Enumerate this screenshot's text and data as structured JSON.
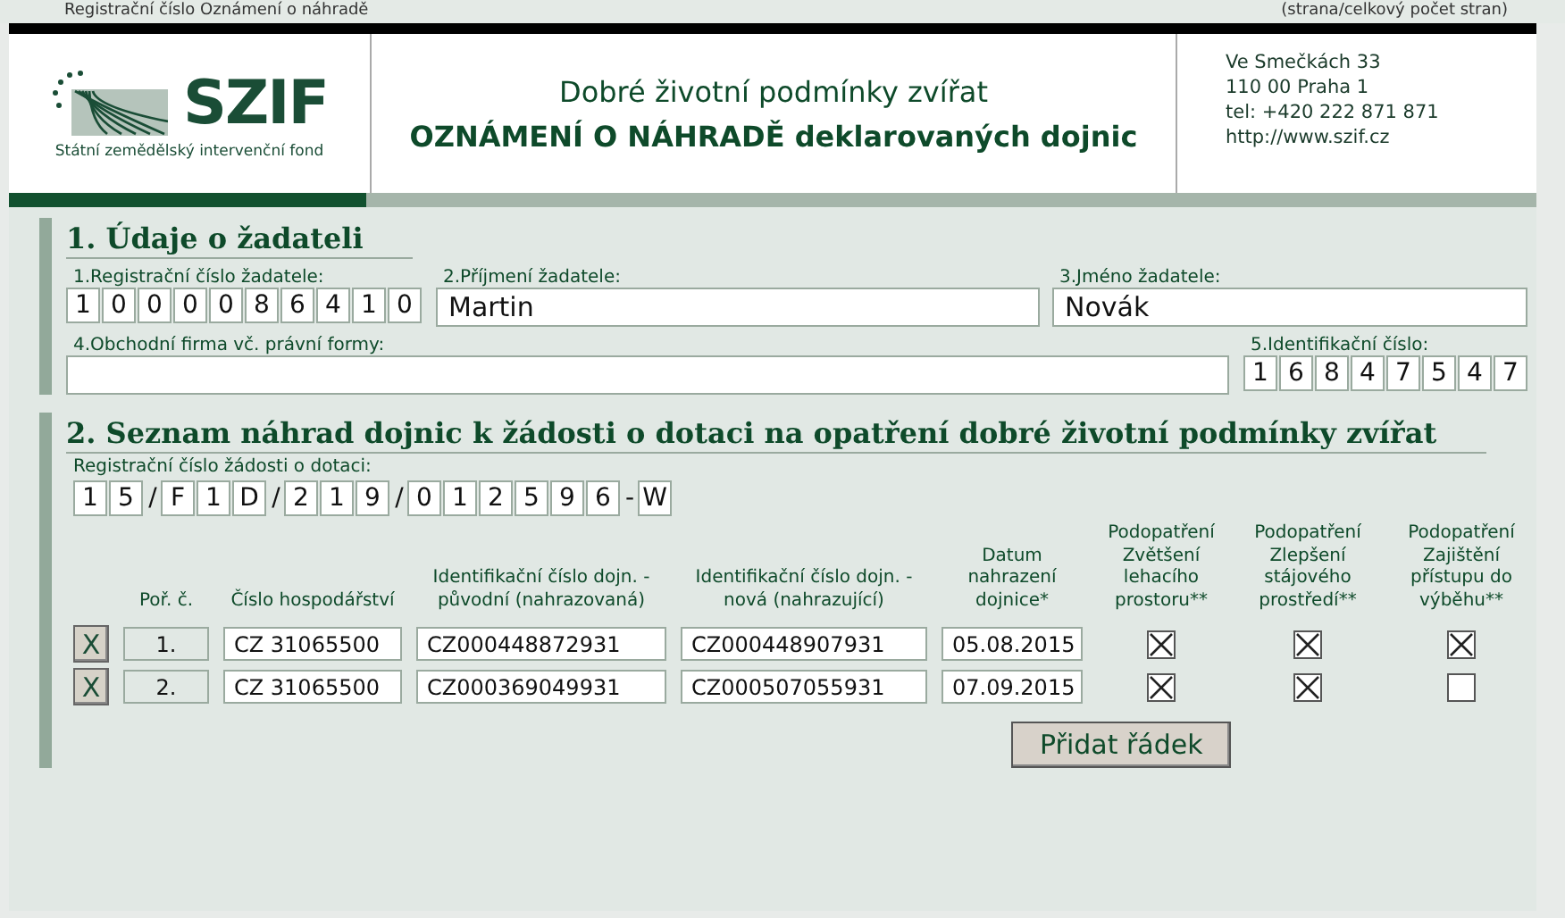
{
  "top_strip": {
    "left": "Registrační číslo Oznámení o náhradě",
    "right": "(strana/celkový počet stran)"
  },
  "header": {
    "logo_text": "SZIF",
    "logo_caption": "Státní zemědělský intervenční fond",
    "subtitle": "Dobré životní podmínky zvířat",
    "title": "OZNÁMENÍ O NÁHRADĚ deklarovaných dojnic",
    "address": [
      "Ve Smečkách 33",
      "110 00 Praha 1",
      "tel: +420 222 871 871",
      "http://www.szif.cz"
    ]
  },
  "section1": {
    "heading": "1. Údaje o žadateli",
    "reg_label": "1.Registrační číslo žadatele:",
    "reg_digits": [
      "1",
      "0",
      "0",
      "0",
      "0",
      "8",
      "6",
      "4",
      "1",
      "0"
    ],
    "surname_label": "2.Příjmení žadatele:",
    "surname": "Martin",
    "name_label": "3.Jméno žadatele:",
    "name": "Novák",
    "firm_label": "4.Obchodní firma vč. právní formy:",
    "id_label": "5.Identifikační číslo:",
    "id_digits": [
      "1",
      "6",
      "8",
      "4",
      "7",
      "5",
      "4",
      "7"
    ]
  },
  "section2": {
    "heading": "2. Seznam náhrad dojnic k žádosti o dotaci na opatření dobré životní podmínky zvířat",
    "app_label": "Registrační číslo žádosti o dotaci:",
    "app_number": [
      {
        "kind": "cell",
        "text": "1"
      },
      {
        "kind": "cell",
        "text": "5"
      },
      {
        "kind": "sep",
        "text": "/"
      },
      {
        "kind": "cell",
        "text": "F"
      },
      {
        "kind": "cell",
        "text": "1"
      },
      {
        "kind": "cell",
        "text": "D"
      },
      {
        "kind": "sep",
        "text": "/"
      },
      {
        "kind": "cell",
        "text": "2"
      },
      {
        "kind": "cell",
        "text": "1"
      },
      {
        "kind": "cell",
        "text": "9"
      },
      {
        "kind": "sep",
        "text": "/"
      },
      {
        "kind": "cell",
        "text": "0"
      },
      {
        "kind": "cell",
        "text": "1"
      },
      {
        "kind": "cell",
        "text": "2"
      },
      {
        "kind": "cell",
        "text": "5"
      },
      {
        "kind": "cell",
        "text": "9"
      },
      {
        "kind": "cell",
        "text": "6"
      },
      {
        "kind": "sep",
        "text": "-"
      },
      {
        "kind": "cell",
        "text": "W"
      }
    ],
    "columns": [
      "Poř. č.",
      "Číslo hospodářství",
      "Identifikační číslo dojn. - původní (nahrazovaná)",
      "Identifikační číslo dojn. - nová (nahrazující)",
      "Datum nahrazení dojnice*",
      "Podopatření Zvětšení lehacího prostoru**",
      "Podopatření Zlepšení stájového prostředí**",
      "Podopatření Zajištění přístupu do výběhu**"
    ],
    "rows": [
      {
        "delete": "X",
        "number": "1.",
        "farm": "CZ 31065500",
        "original": "CZ000448872931",
        "new": "CZ000448907931",
        "date": "05.08.2015",
        "checks": [
          true,
          true,
          true
        ]
      },
      {
        "delete": "X",
        "number": "2.",
        "farm": "CZ 31065500",
        "original": "CZ000369049931",
        "new": "CZ000507055931",
        "date": "07.09.2015",
        "checks": [
          true,
          true,
          false
        ]
      }
    ],
    "add_button": "Přidat řádek"
  }
}
